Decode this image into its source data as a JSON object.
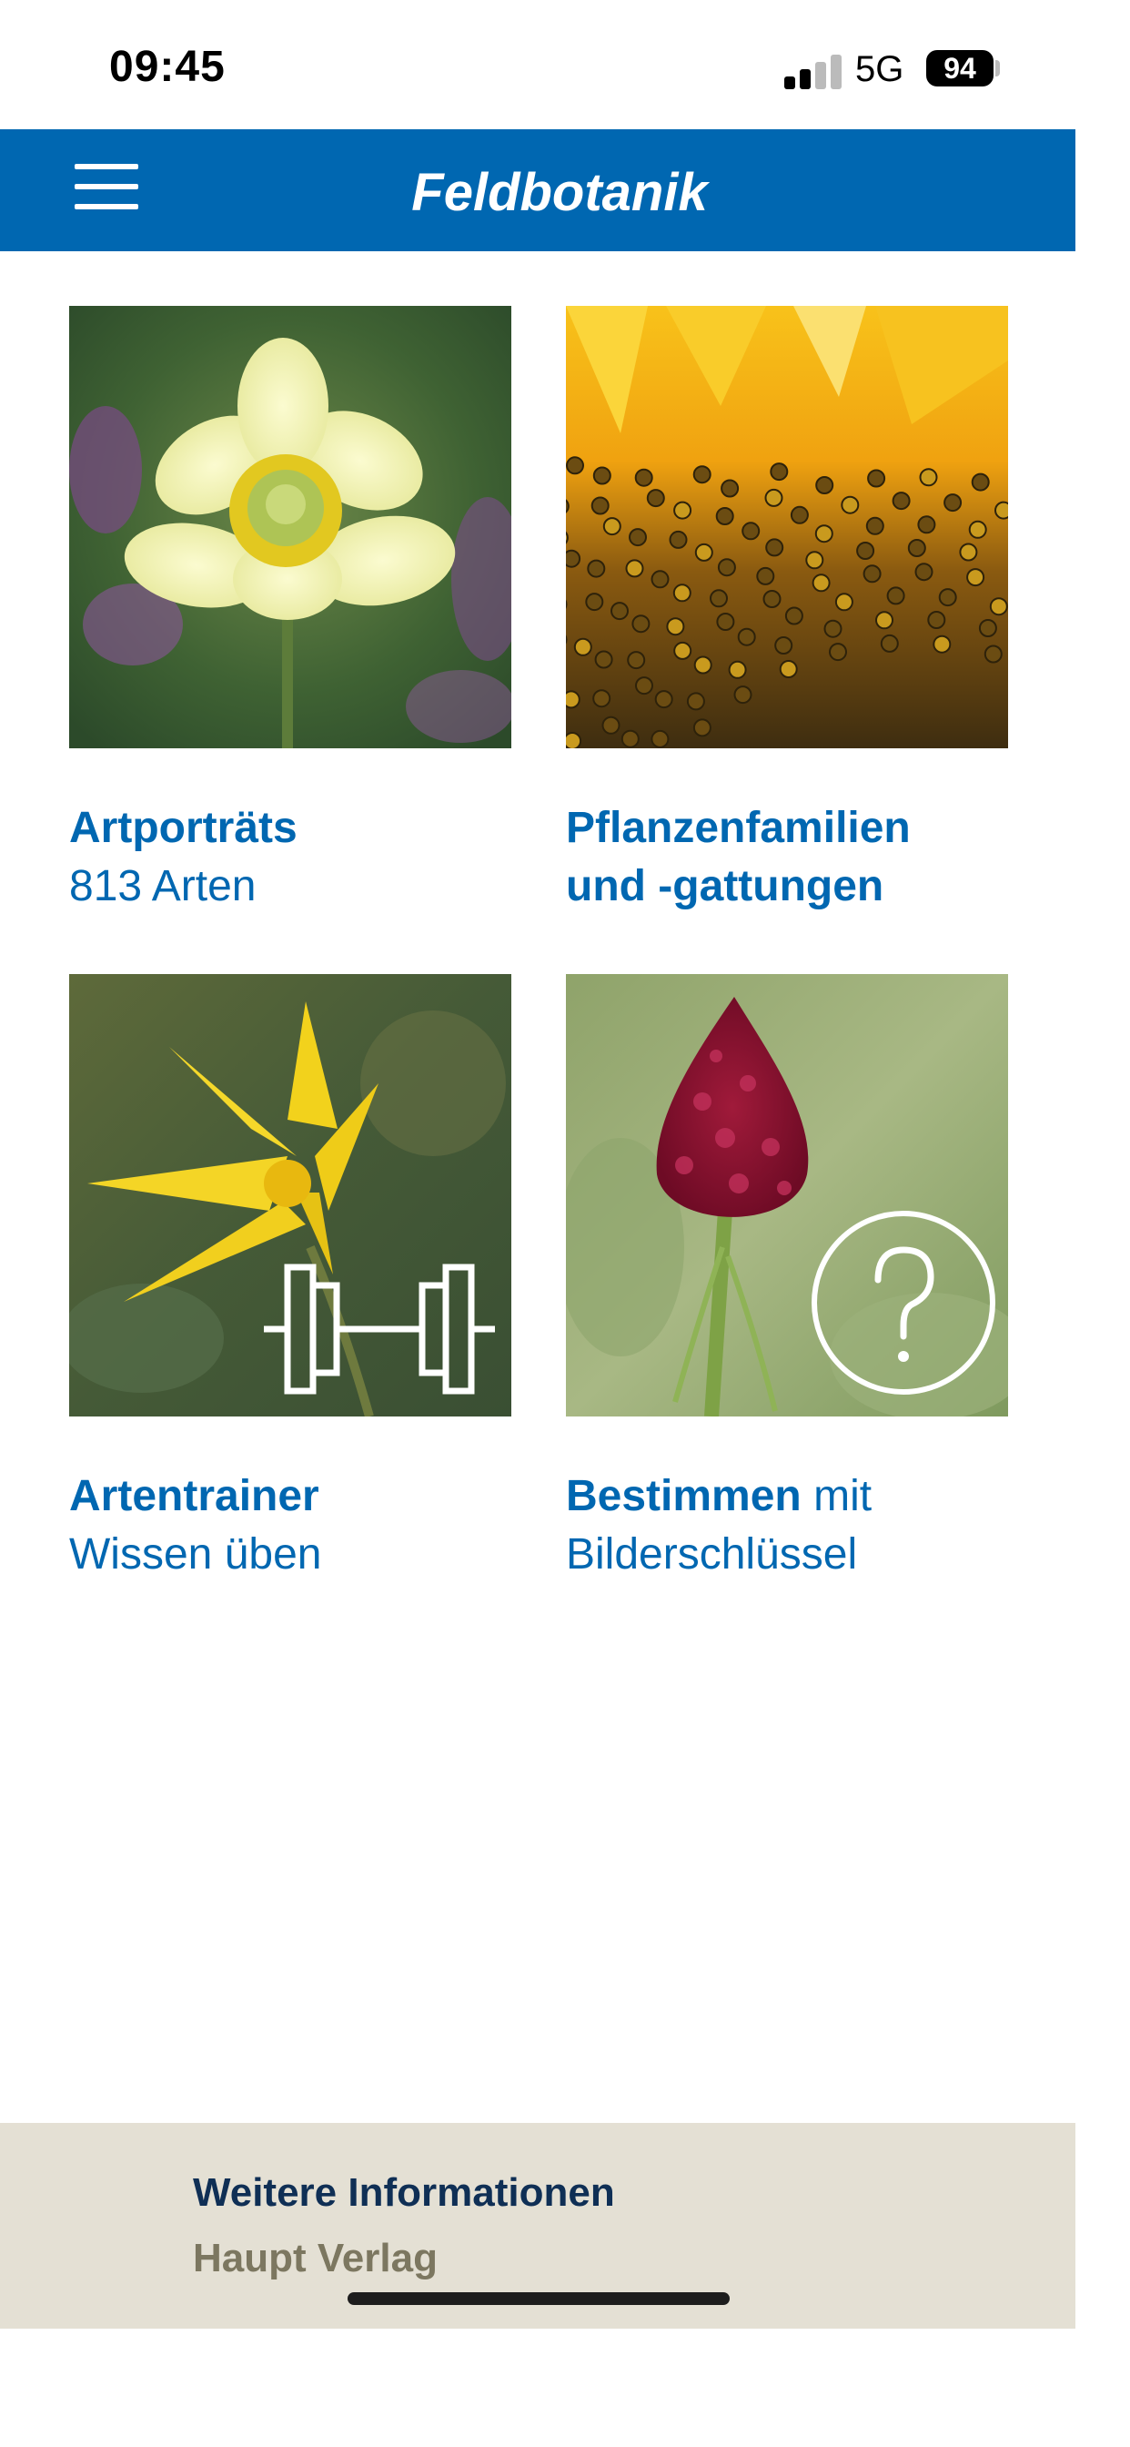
{
  "status_bar": {
    "time": "09:45",
    "network": "5G",
    "battery": "94"
  },
  "header": {
    "title": "Feldbotanik",
    "menu_icon": "hamburger-menu-icon"
  },
  "tiles": [
    {
      "title": "Artporträts",
      "subtitle": "813 Arten",
      "image": "pasque-flower-photo"
    },
    {
      "title": "Pflanzenfamilien",
      "subtitle": "und -gattungen",
      "image": "sunflower-closeup-photo"
    },
    {
      "title": "Artentrainer",
      "subtitle": "Wissen üben",
      "image": "yellow-tulip-photo",
      "overlay_icon": "dumbbell-icon"
    },
    {
      "title": "Bestimmen",
      "title_suffix": " mit",
      "subtitle": "Bilderschlüssel",
      "image": "black-vanilla-orchid-photo",
      "overlay_icon": "question-circle-icon"
    }
  ],
  "footer": {
    "title": "Weitere Informationen",
    "subtitle": "Haupt Verlag"
  },
  "colors": {
    "primary": "#0067b1",
    "footer_bg": "#e4e0d4",
    "footer_title": "#0f2f55",
    "footer_sub": "#7c7760"
  }
}
